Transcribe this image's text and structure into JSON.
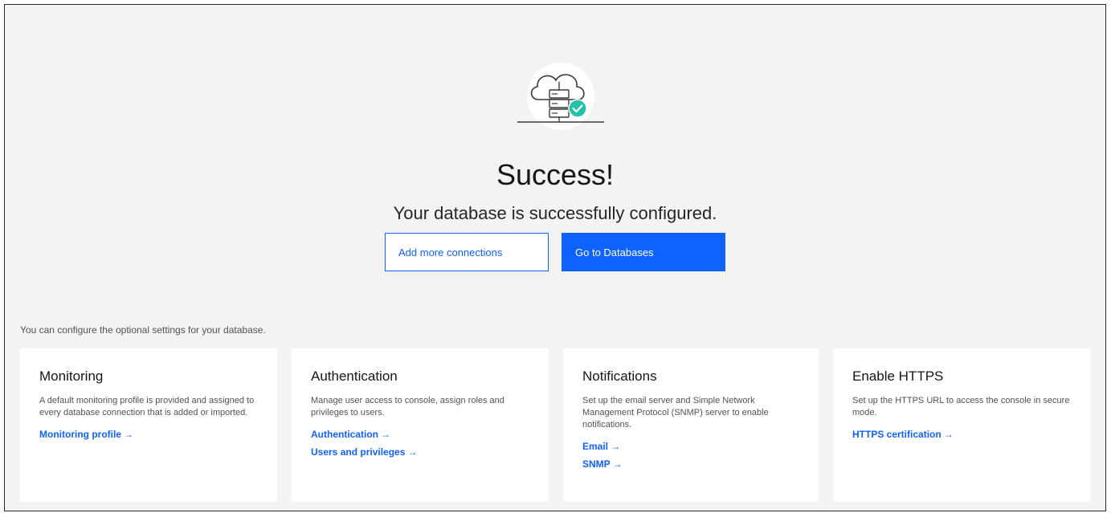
{
  "header": {
    "illustration_icon": "cloud-database-success-icon",
    "title": "Success!",
    "subtitle": "Your database is successfully configured."
  },
  "actions": {
    "secondary_label": "Add more connections",
    "primary_label": "Go to Databases"
  },
  "intro_text": "You can configure the optional settings for your database.",
  "cards": [
    {
      "title": "Monitoring",
      "description": "A default monitoring profile is provided and assigned to every database connection that is added or imported.",
      "links": [
        "Monitoring profile"
      ]
    },
    {
      "title": "Authentication",
      "description": "Manage user access to console, assign roles and privileges to users.",
      "links": [
        "Authentication",
        "Users and privileges"
      ]
    },
    {
      "title": "Notifications",
      "description": "Set up the email server and Simple Network Management Protocol (SNMP) server to enable notifications.",
      "links": [
        "Email",
        "SNMP"
      ]
    },
    {
      "title": "Enable HTTPS",
      "description": "Set up the HTTPS URL to access the console in secure mode.",
      "links": [
        "HTTPS certification"
      ]
    }
  ],
  "link_arrow": "→",
  "colors": {
    "accent": "#0f62fe",
    "success": "#24c2a6",
    "page_background": "#f3f3f3"
  }
}
